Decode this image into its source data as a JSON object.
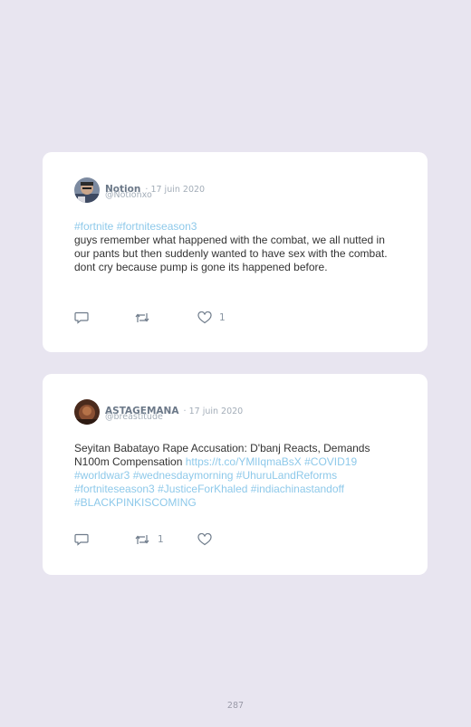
{
  "tweets": [
    {
      "author": "Notion",
      "date": "· 17 juin 2020",
      "handle": "@Notionxo",
      "hashtags": "#fortnite #fortniteseason3",
      "text": "guys remember what happened with the combat, we all nutted in our pants but then suddenly wanted to have sex with the combat. dont cry because pump is gone its happened before.",
      "retweets": "",
      "likes": "1"
    },
    {
      "author": "ASTAGEMANA",
      "date": "· 17 juin 2020",
      "handle": "@breastitude",
      "text": "Seyitan Babatayo Rape Accusation: D'banj Reacts, Demands N100m Compensation ",
      "link": "https://t.co/YMlIqmaBsX",
      "hashtags": "#COVID19 #worldwar3 #wednesdaymorning #UhuruLandReforms #fortniteseason3 #JusticeForKhaled #indiachinastandoff #BLACKPINKISCOMING",
      "retweets": "1",
      "likes": ""
    }
  ],
  "icons": [
    "reply-icon",
    "retweet-icon",
    "heart-icon"
  ],
  "colors": {
    "background": "#e8e5f0",
    "card": "#ffffff",
    "link": "#8ec9ea"
  },
  "page_number": "287"
}
